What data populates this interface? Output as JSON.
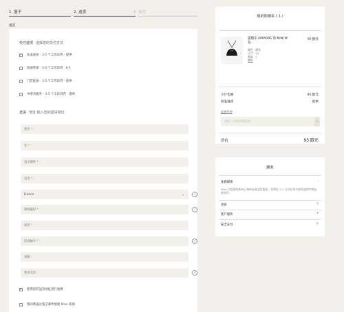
{
  "steps": [
    {
      "label": "1. 篮子"
    },
    {
      "label": "2. 送货"
    },
    {
      "label": "3. 支付"
    }
  ],
  "section_label": "送货",
  "delivery": {
    "title": "交付选项",
    "subtitle": "选择您的交付方式",
    "options": [
      {
        "label": "标准送货 - 3-5 个工作日内 - 提供",
        "checked": true
      },
      {
        "label": "快速传递 - 3-5 个工作日内 - 8 €",
        "checked": false
      },
      {
        "label": "门店配送 - 3-5 个工作日内 - 提供",
        "checked": false
      },
      {
        "label": "中继点服务 - 3-5 个工作日内 - 提供",
        "checked": false
      }
    ]
  },
  "address": {
    "title": "送货",
    "subtitle": "地址 输入您的送货地址",
    "fields": {
      "last_name": "姓名 * :",
      "first_name": "名 * :",
      "email": "电子邮件 * :",
      "phone": "电话 * :",
      "country": "France",
      "postcode": "邮政编码 * :",
      "city": "城市 * :",
      "street": "街道编号 * :",
      "street2": "道路 :",
      "more_info": "更多信息 :"
    },
    "help_glyph": "?",
    "use_for_billing": "使用您的送货地址进行收费",
    "newsletter": "我同意通过电子邮件接收 Mise 新闻"
  },
  "cart": {
    "title": "我的购物车 ( 1 )",
    "product": {
      "name": "适用于 AIRPODS 的 MINI M 包",
      "price": "95 欧元",
      "color": "颜色 : 黑色",
      "size": "尺寸 : TU",
      "quantity": "数量 : 1",
      "remove": "删除"
    },
    "subtotal_label": "小计包库",
    "subtotal_value": "95 欧元",
    "shipping_label": "标准送货",
    "shipping_value": "提供",
    "promo_link": "促销代码",
    "promo_placeholder": "例如 : 3457345345",
    "promo_button": "›",
    "total_label": "总价",
    "total_value": "95 欧元"
  },
  "services": {
    "title": "服务",
    "free_shipping": "免费邮寄",
    "free_shipping_desc": "Mise 为您提供所有订单的标准送货服务。您将在 3-5 天内在家中或您选择的商店收到它。",
    "returns": "退货",
    "support": "客户服务",
    "secure_payment": "安全支付",
    "minus": "–",
    "plus": "+"
  }
}
